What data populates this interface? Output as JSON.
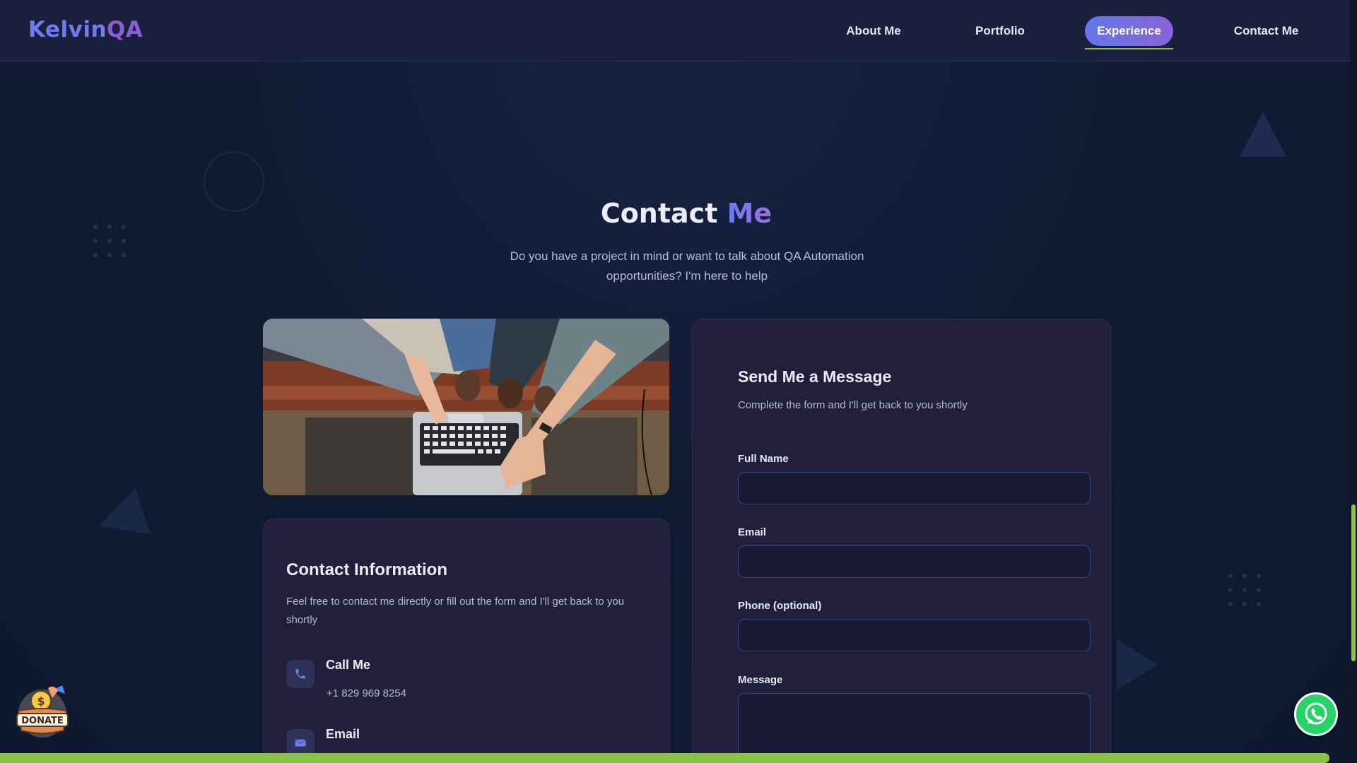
{
  "header": {
    "logo_first": "Kelvin",
    "logo_second": "QA",
    "nav": [
      {
        "label": "About Me"
      },
      {
        "label": "Portfolio"
      },
      {
        "label": "Experience",
        "active": true
      },
      {
        "label": "Contact Me"
      }
    ]
  },
  "section": {
    "title_main": "Contact ",
    "title_accent": "Me",
    "subtitle": "Do you have a project in mind or want to talk about QA Automation opportunities? I'm here to help"
  },
  "contact_info": {
    "title": "Contact Information",
    "description": "Feel free to contact me directly or fill out the form and I'll get back to you shortly",
    "items": [
      {
        "label": "Call Me",
        "value": "+1 829 969 8254",
        "icon": "phone-icon"
      },
      {
        "label": "Email",
        "icon": "envelope-icon"
      }
    ]
  },
  "form": {
    "title": "Send Me a Message",
    "subtitle": "Complete the form and I'll get back to you shortly",
    "fields": [
      {
        "label": "Full Name",
        "value": ""
      },
      {
        "label": "Email",
        "value": ""
      },
      {
        "label": "Phone (optional)",
        "value": ""
      },
      {
        "label": "Message",
        "value": ""
      }
    ]
  },
  "floating": {
    "donate_label": "DONATE",
    "whatsapp_icon": "whatsapp-icon"
  },
  "colors": {
    "background": "#101b33",
    "header": "#1b1f3e",
    "card": "#221f3d",
    "accent_blue": "#6d7cf0",
    "accent_purple": "#8a5fd6",
    "accent_green": "#8bc34a",
    "whatsapp": "#25d366"
  }
}
